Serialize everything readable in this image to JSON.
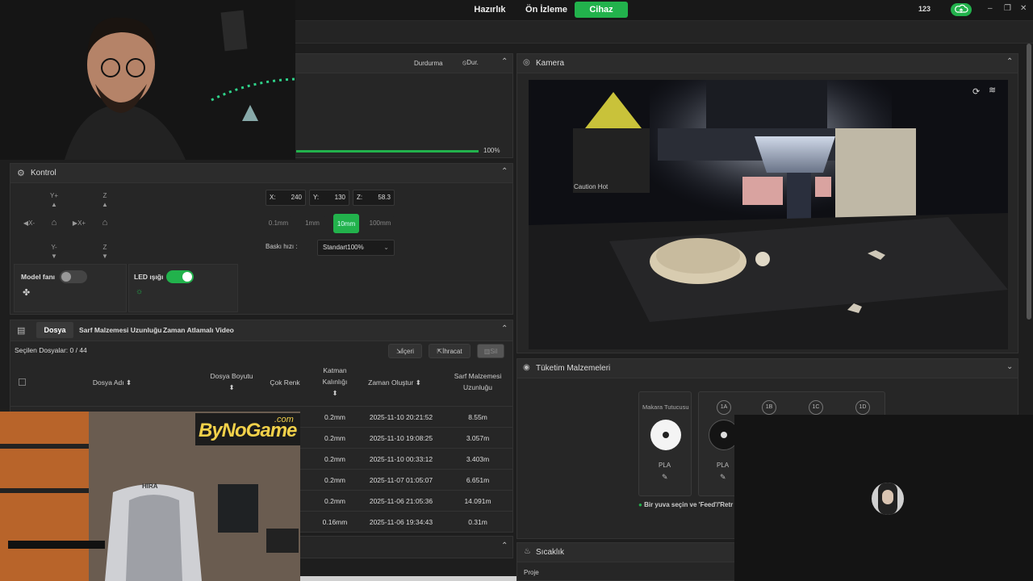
{
  "top_nav": {
    "tabs": [
      "Hazırlık",
      "Ön İzleme",
      "Cihaz"
    ],
    "active_tab": "Cihaz",
    "counter": "123"
  },
  "window_controls": {
    "minimize": "–",
    "restore": "❐",
    "close": "✕"
  },
  "print_panel": {
    "stop_label": "Durdurma",
    "pause_label": "Dur.",
    "progress": 1.0,
    "progress_text": "100%"
  },
  "control_panel": {
    "title": "Kontrol",
    "jog": {
      "y_plus": "Y+",
      "y_minus": "Y-",
      "x_minus": "X-",
      "x_plus": "X+",
      "z_up": "Z",
      "z_down": "Z"
    },
    "axes": {
      "x_label": "X:",
      "x_value": "240",
      "y_label": "Y:",
      "y_value": "130",
      "z_label": "Z:",
      "z_value": "58.3"
    },
    "steps": [
      "0.1mm",
      "1mm",
      "10mm",
      "100mm"
    ],
    "active_step": "10mm",
    "speed_label": "Baskı hızı :",
    "speed_value": "Standart100%",
    "fan_label": "Model fanı",
    "led_label": "LED ışığı"
  },
  "files_panel": {
    "tabs": [
      "Dosya",
      "Sarf Malzemesi Uzunluğu",
      "Zaman Atlamalı Video"
    ],
    "selected_text": "Seçilen Dosyalar: 0 / 44",
    "import_label": "İçeri",
    "export_label": "İhracat",
    "delete_label": "Sil",
    "columns": [
      "Dosya Adı",
      "Dosya Boyutu",
      "Çok Renk",
      "Katman Kalınlığı",
      "Zaman Oluştur",
      "Sarf Malzemesi Uzunluğu"
    ],
    "rows": [
      {
        "layer": "0.2mm",
        "time": "2025-11-10 20:21:52",
        "length": "8.55m"
      },
      {
        "layer": "0.2mm",
        "time": "2025-11-10 19:08:25",
        "length": "3.057m"
      },
      {
        "layer": "0.2mm",
        "time": "2025-11-10 00:33:12",
        "length": "3.403m"
      },
      {
        "layer": "0.2mm",
        "time": "2025-11-07 01:05:07",
        "length": "6.651m"
      },
      {
        "layer": "0.2mm",
        "time": "2025-11-06 21:05:36",
        "length": "14.091m"
      },
      {
        "layer": "0.16mm",
        "time": "2025-11-06 19:34:43",
        "length": "0.31m"
      }
    ]
  },
  "camera_panel": {
    "title": "Kamera",
    "sign_text": "Caution Hot"
  },
  "filament_panel": {
    "title": "Tüketim Malzemeleri",
    "spool_holder_label": "Makara Tutucusu",
    "slots": [
      "1A",
      "1B",
      "1C",
      "1D"
    ],
    "materials": [
      "PLA",
      "PLA"
    ],
    "hint": "Bir yuva seçin ve 'Feed'/'Retr"
  },
  "temp_panel": {
    "title": "Sıcaklık",
    "project_label": "Proje"
  },
  "overlay": {
    "logo_text": "ByNoGame",
    "logo_suffix": ".com",
    "chair_text": "HIRA"
  },
  "colors": {
    "accent": "#22b24c",
    "panel": "#262626",
    "background": "#1e1e1e"
  }
}
